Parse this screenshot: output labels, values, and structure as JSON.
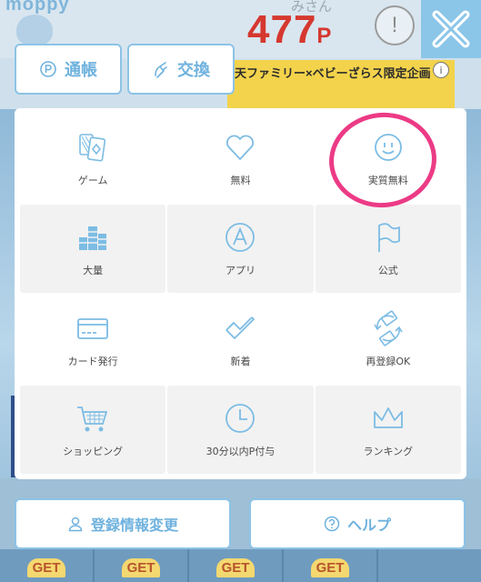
{
  "header": {
    "logo": "moppy",
    "user_name": "みさん",
    "points_value": "477",
    "points_unit": "P",
    "info_icon": "!"
  },
  "banner": {
    "text": "天ファミリー×ベビーざらス限定企画",
    "info": "i"
  },
  "top_buttons": {
    "passbook_label": "通帳",
    "exchange_label": "交換"
  },
  "menu": {
    "items": [
      {
        "label": "ゲーム",
        "icon": "cards-icon"
      },
      {
        "label": "無料",
        "icon": "heart-icon"
      },
      {
        "label": "実質無料",
        "icon": "smile-icon"
      },
      {
        "label": "大量",
        "icon": "buildings-icon"
      },
      {
        "label": "アプリ",
        "icon": "app-icon"
      },
      {
        "label": "公式",
        "icon": "flag-icon"
      },
      {
        "label": "カード発行",
        "icon": "credit-card-icon"
      },
      {
        "label": "新着",
        "icon": "check-icon"
      },
      {
        "label": "再登録OK",
        "icon": "refresh-icon"
      },
      {
        "label": "ショッピング",
        "icon": "cart-icon"
      },
      {
        "label": "30分以内P付与",
        "icon": "clock-icon"
      },
      {
        "label": "ランキング",
        "icon": "crown-icon"
      }
    ]
  },
  "bottom_buttons": {
    "profile_label": "登録情報変更",
    "help_label": "ヘルプ"
  },
  "bottom_strip": {
    "badges": [
      "GET",
      "GET",
      "GET",
      "GET"
    ]
  },
  "colors": {
    "accent": "#6fb2de",
    "border": "#8cc3e6",
    "points": "#d6382f",
    "annotation": "#ec3b86"
  }
}
